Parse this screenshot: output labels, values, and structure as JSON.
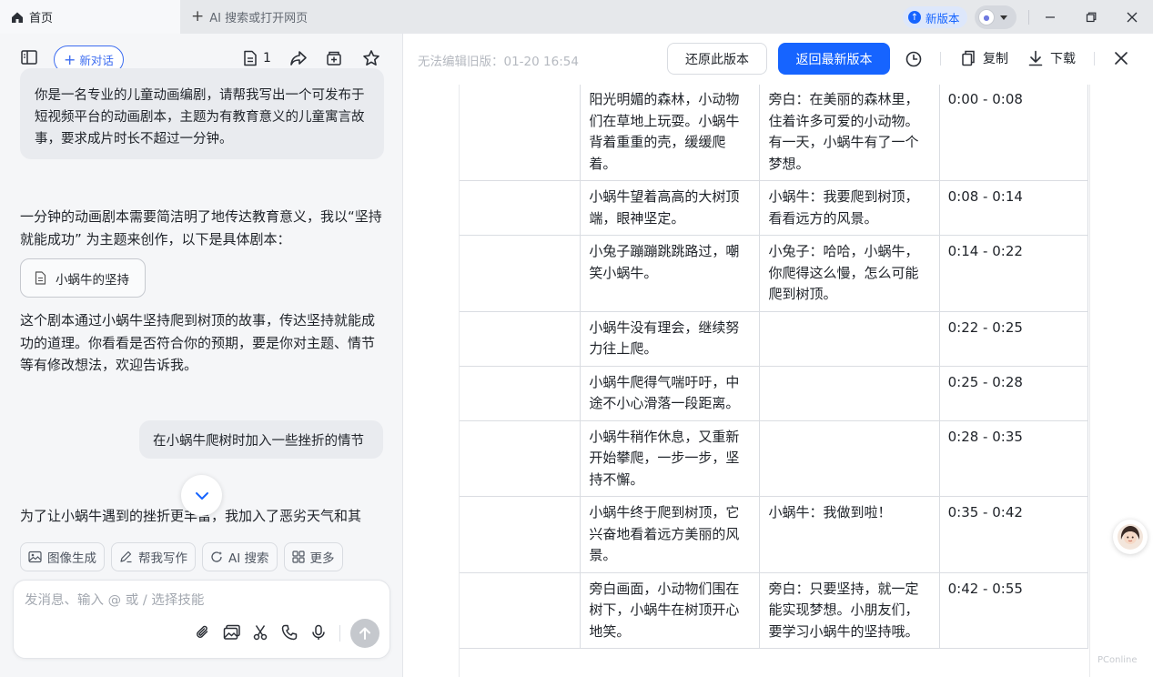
{
  "titlebar": {
    "home_tab": "首页",
    "new_tab": "AI 搜索或打开网页",
    "new_version": "新版本"
  },
  "left": {
    "new_chat": "新对话",
    "doc_count": "1",
    "user_msg_1": "你是一名专业的儿童动画编剧，请帮我写出一个可发布于短视频平台的动画剧本，主题为有教育意义的儿童寓言故事，要求成片时长不超过一分钟。",
    "bot_text_1": "一分钟的动画剧本需要简洁明了地传达教育意义，我以“坚持就能成功” 为主题来创作，以下是具体剧本：",
    "doc_card": "小蜗牛的坚持",
    "bot_text_2": "这个剧本通过小蜗牛坚持爬到树顶的故事，传达坚持就能成功的道理。你看看是否符合你的预期，要是你对主题、情节等有修改想法，欢迎告诉我。",
    "user_msg_2": "在小蜗牛爬树时加入一些挫折的情节",
    "bot_text_3": "为了让小蜗牛遇到的挫折更丰富，我加入了恶劣天气和其",
    "skills": [
      "图像生成",
      "帮我写作",
      "AI 搜索",
      "更多"
    ],
    "composer_placeholder": "发消息、输入 @ 或 / 选择技能"
  },
  "right": {
    "version_info": "无法编辑旧版：01-20 16:54",
    "restore": "还原此版本",
    "latest": "返回最新版本",
    "copy": "复制",
    "download": "下载"
  },
  "table": {
    "rows": [
      {
        "c1": "",
        "c2": "阳光明媚的森林，小动物们在草地上玩耍。小蜗牛背着重重的壳，缓缓爬着。",
        "c3": "旁白：在美丽的森林里，住着许多可爱的小动物。有一天，小蜗牛有了一个梦想。",
        "c4": "0:00 - 0:08"
      },
      {
        "c1": "",
        "c2": "小蜗牛望着高高的大树顶端，眼神坚定。",
        "c3": "小蜗牛：我要爬到树顶，看看远方的风景。",
        "c4": "0:08 - 0:14"
      },
      {
        "c1": "",
        "c2": "小兔子蹦蹦跳跳路过，嘲笑小蜗牛。",
        "c3": "小兔子：哈哈，小蜗牛，你爬得这么慢，怎么可能爬到树顶。",
        "c4": "0:14 - 0:22"
      },
      {
        "c1": "",
        "c2": "小蜗牛没有理会，继续努力往上爬。",
        "c3": "",
        "c4": "0:22 - 0:25"
      },
      {
        "c1": "",
        "c2": "小蜗牛爬得气喘吁吁，中途不小心滑落一段距离。",
        "c3": "",
        "c4": "0:25 - 0:28"
      },
      {
        "c1": "",
        "c2": "小蜗牛稍作休息，又重新开始攀爬，一步一步，坚持不懈。",
        "c3": "",
        "c4": "0:28 - 0:35"
      },
      {
        "c1": "",
        "c2": "小蜗牛终于爬到树顶，它兴奋地看着远方美丽的风景。",
        "c3": "小蜗牛：我做到啦！",
        "c4": "0:35 - 0:42"
      },
      {
        "c1": "",
        "c2": "旁白画面，小动物们围在树下，小蜗牛在树顶开心地笑。",
        "c3": "旁白：只要坚持，就一定能实现梦想。小朋友们，要学习小蜗牛的坚持哦。",
        "c4": "0:42 - 0:55"
      }
    ]
  },
  "watermark": "PConline",
  "colors": {
    "accent": "#1664ff",
    "chip_border": "#3c6cf0"
  },
  "icons": [
    "home-icon",
    "plus-icon",
    "upgrade-icon",
    "user-avatar-icon",
    "minimize-icon",
    "restore-window-icon",
    "close-window-icon",
    "sidebar-toggle-icon",
    "document-icon",
    "share-icon",
    "archive-icon",
    "star-icon",
    "chevron-down-icon",
    "image-icon",
    "pen-icon",
    "search-spark-icon",
    "grid-icon",
    "attach-icon",
    "picture-icon",
    "scissors-icon",
    "phone-icon",
    "mic-icon",
    "send-arrow-icon",
    "history-icon",
    "copy-icon",
    "download-icon",
    "close-icon",
    "assistant-avatar-icon"
  ]
}
